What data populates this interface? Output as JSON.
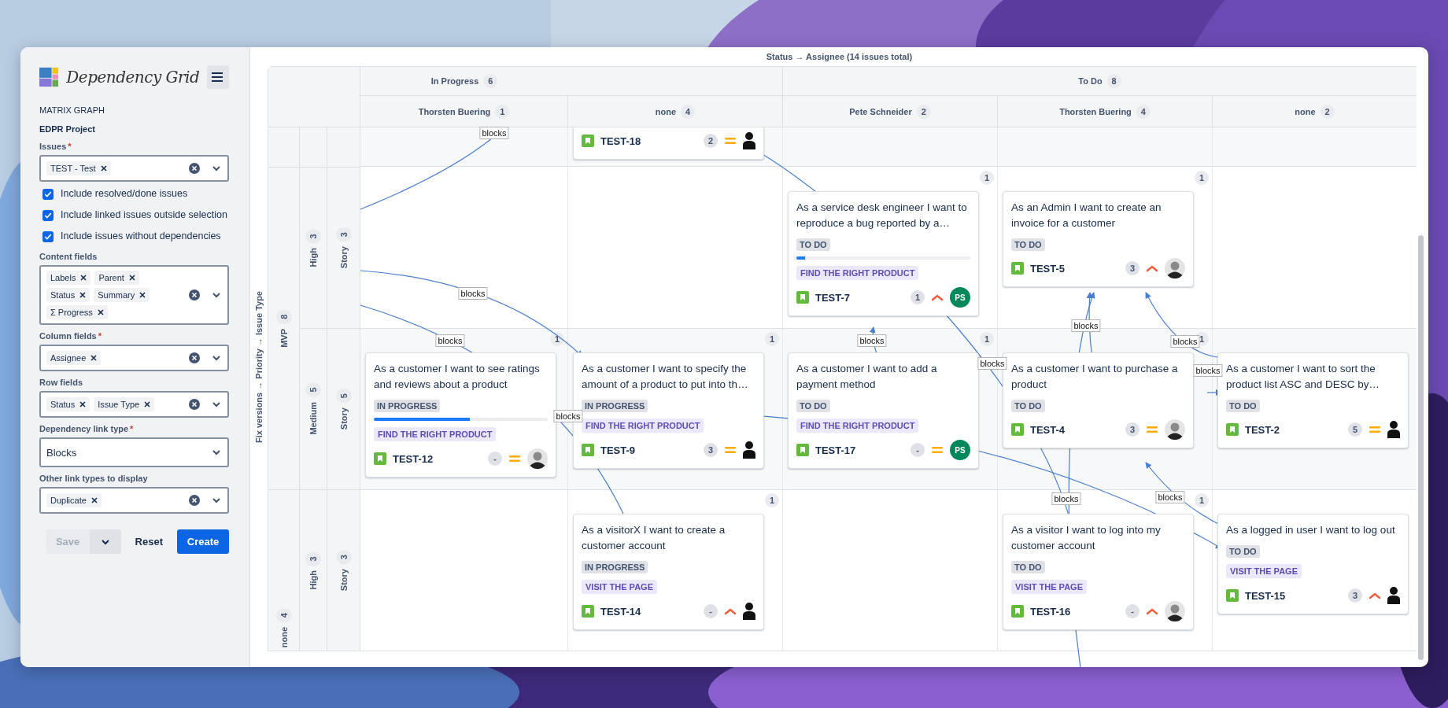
{
  "window": {
    "title": "Status → Assignee (14 issues total)"
  },
  "sidebar": {
    "app_title": "Dependency Grid",
    "section": "MATRIX GRAPH",
    "project": "EDPR Project",
    "form": [
      {
        "kind": "tags",
        "label": "Issues",
        "required_mark": "*",
        "tags": [
          "TEST - Test"
        ]
      },
      {
        "kind": "checkbox",
        "label": "Include resolved/done issues",
        "checked": true
      },
      {
        "kind": "checkbox",
        "label": "Include linked issues outside selection",
        "checked": true
      },
      {
        "kind": "checkbox",
        "label": "Include issues without dependencies",
        "checked": true
      },
      {
        "kind": "tags",
        "label": "Content fields",
        "tags": [
          "Labels",
          "Parent",
          "Status",
          "Summary",
          "Σ Progress"
        ]
      },
      {
        "kind": "tags",
        "label": "Column fields",
        "required_mark": "*",
        "tags": [
          "Assignee"
        ]
      },
      {
        "kind": "tags",
        "label": "Row fields",
        "tags": [
          "Status",
          "Issue Type"
        ]
      },
      {
        "kind": "select",
        "label": "Dependency link type",
        "required_mark": "*",
        "value": "Blocks"
      },
      {
        "kind": "tags",
        "label": "Other link types to display",
        "tags": [
          "Duplicate"
        ]
      }
    ],
    "buttons": [
      {
        "kind": "secondary",
        "label": "Save",
        "disabled": true
      },
      {
        "kind": "menu",
        "disabled": true
      },
      {
        "kind": "subtle",
        "label": "Reset",
        "disabled": false
      },
      {
        "kind": "primary",
        "label": "Create",
        "disabled": false
      }
    ]
  },
  "grid": {
    "axis_label": "Fix versions → Priority → Issue Type",
    "status_groups": [
      {
        "name": "In Progress",
        "count": "6",
        "assignees": [
          {
            "name": "Thorsten Buering",
            "count": "1"
          },
          {
            "name": "none",
            "count": "4"
          }
        ]
      },
      {
        "name": "To Do",
        "count": "8",
        "assignees": [
          {
            "name": "Pete Schneider",
            "count": "2"
          },
          {
            "name": "Thorsten Buering",
            "count": "4"
          },
          {
            "name": "none",
            "count": "2"
          }
        ]
      }
    ],
    "row_groups": [
      {
        "rows": [
          {
            "kind": "clipped",
            "cells": [
              {},
              {
                "card": {
                  "kind": "clipped",
                  "key": "TEST-18",
                  "count": "2",
                  "priority": {
                    "kind": "medium"
                  },
                  "avatar": {
                    "kind": "person"
                  }
                }
              },
              {},
              {},
              {}
            ]
          }
        ]
      },
      {
        "name": "MVP",
        "count": "8",
        "rows": [
          {
            "kind": "full",
            "priority": "High",
            "priority_count": "3",
            "type": "Story",
            "type_count": "3",
            "cells": [
              {},
              {},
              {
                "count": "1",
                "card": {
                  "kind": "full",
                  "summary": "As a service desk engineer I want to reproduce a bug reported by a…",
                  "status": "TO DO",
                  "level": 0.05,
                  "label": "FIND THE RIGHT PRODUCT",
                  "key": "TEST-7",
                  "count": "1",
                  "priority": {
                    "kind": "high"
                  },
                  "avatar": {
                    "kind": "initials",
                    "initials": "PS",
                    "color": "#00875a"
                  }
                }
              },
              {
                "count": "1",
                "card": {
                  "kind": "full",
                  "summary": "As an Admin I want to create an invoice for a customer",
                  "status": "TO DO",
                  "key": "TEST-5",
                  "count": "3",
                  "priority": {
                    "kind": "high"
                  }
                }
              },
              {}
            ]
          },
          {
            "kind": "full",
            "priority": "Medium",
            "priority_count": "5",
            "type": "Story",
            "type_count": "5",
            "cells": [
              {
                "count": "1",
                "card": {
                  "kind": "full",
                  "summary": "As a customer I want to see ratings and reviews about a product",
                  "status": "IN PROGRESS",
                  "level": 0.55,
                  "label": "FIND THE RIGHT PRODUCT",
                  "key": "TEST-12",
                  "count": "-",
                  "priority": {
                    "kind": "medium"
                  }
                }
              },
              {
                "count": "1",
                "card": {
                  "kind": "full",
                  "summary": "As a customer I want to specify the amount of a product to put into th…",
                  "status": "IN PROGRESS",
                  "label": "FIND THE RIGHT PRODUCT",
                  "key": "TEST-9",
                  "count": "3",
                  "priority": {
                    "kind": "medium"
                  },
                  "avatar": {
                    "kind": "person"
                  }
                }
              },
              {
                "count": "1",
                "card": {
                  "kind": "full",
                  "summary": "As a customer I want to add a payment method",
                  "status": "TO DO",
                  "label": "FIND THE RIGHT PRODUCT",
                  "key": "TEST-17",
                  "count": "-",
                  "priority": {
                    "kind": "medium"
                  },
                  "avatar": {
                    "kind": "initials",
                    "initials": "PS",
                    "color": "#00875a"
                  }
                }
              },
              {
                "count": "1",
                "card": {
                  "kind": "full",
                  "summary": "As a customer I want to purchase a product",
                  "status": "TO DO",
                  "key": "TEST-4",
                  "count": "3",
                  "priority": {
                    "kind": "medium"
                  }
                }
              },
              {
                "card": {
                  "kind": "full",
                  "summary": "As a customer I want to sort the product list ASC and DESC by…",
                  "status": "TO DO",
                  "key": "TEST-2",
                  "count": "5",
                  "priority": {
                    "kind": "medium"
                  },
                  "avatar": {
                    "kind": "person"
                  }
                }
              }
            ]
          }
        ]
      },
      {
        "name": "none",
        "count": "4",
        "rows": [
          {
            "kind": "full",
            "priority": "High",
            "priority_count": "3",
            "type": "Story",
            "type_count": "3",
            "cells": [
              {},
              {
                "count": "1",
                "card": {
                  "kind": "full",
                  "summary": "As a visitorX I want to create a customer account",
                  "status": "IN PROGRESS",
                  "label": "VISIT THE PAGE",
                  "key": "TEST-14",
                  "count": "-",
                  "priority": {
                    "kind": "high"
                  },
                  "avatar": {
                    "kind": "person"
                  }
                }
              },
              {},
              {
                "count": "1",
                "card": {
                  "kind": "full",
                  "summary": "As a visitor I want to log into my customer account",
                  "status": "TO DO",
                  "label": "VISIT THE PAGE",
                  "key": "TEST-16",
                  "count": "-",
                  "priority": {
                    "kind": "high"
                  }
                }
              },
              {
                "card": {
                  "kind": "full",
                  "summary": "As a logged in user I want to log out",
                  "status": "TO DO",
                  "label": "VISIT THE PAGE",
                  "key": "TEST-15",
                  "count": "3",
                  "priority": {
                    "kind": "high"
                  },
                  "avatar": {
                    "kind": "person"
                  }
                }
              }
            ]
          }
        ]
      }
    ]
  },
  "links": [
    {
      "label": "blocks"
    },
    {
      "label": "blocks"
    },
    {
      "label": "blocks"
    },
    {
      "label": "blocks"
    },
    {
      "label": "blocks"
    },
    {
      "label": "blocks"
    },
    {
      "label": "blocks"
    },
    {
      "label": "blocks"
    },
    {
      "label": "blocks"
    },
    {
      "label": "blocks"
    },
    {
      "label": "blocks"
    }
  ]
}
